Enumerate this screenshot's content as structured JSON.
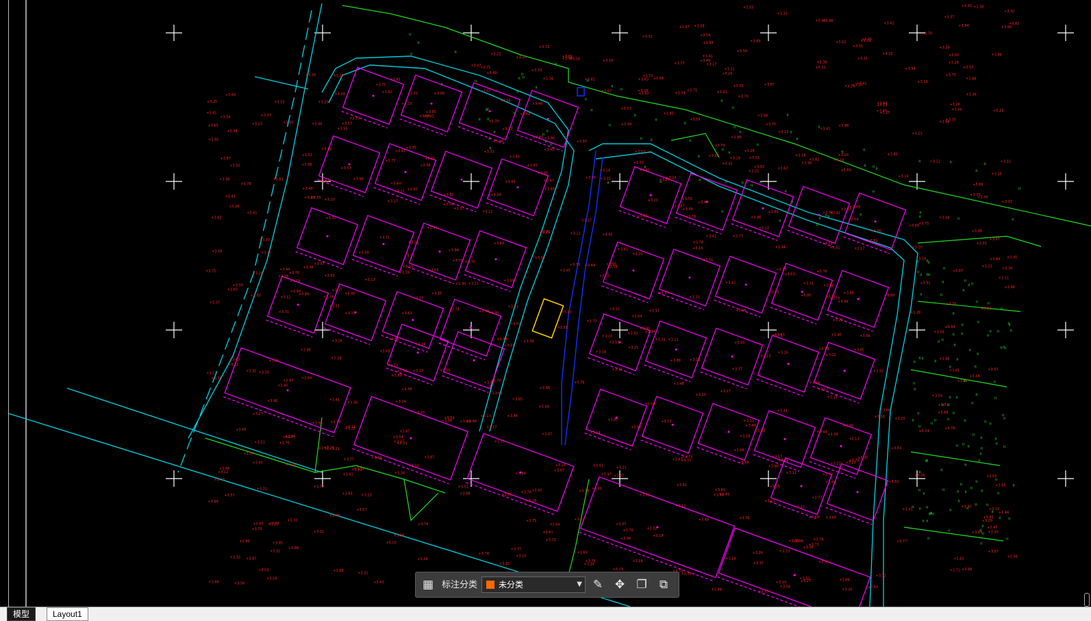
{
  "tabs": {
    "model": "模型",
    "layout1": "Layout1"
  },
  "toolbar": {
    "label": "标注分类",
    "select_value": "未分类",
    "icons": [
      "grid-icon",
      "edit-icon",
      "move-icon",
      "copy-icon",
      "paste-icon"
    ]
  },
  "colors": {
    "background": "#000000",
    "elevation_text": "#ff2020",
    "buildings": "#ff00ff",
    "roads": "#00c8d8",
    "boundaries": "#22dd22",
    "channel": "#1030ff",
    "highlight": "#ffd200",
    "crosshair": "#ffffff",
    "swatch": "#ff6a00"
  }
}
